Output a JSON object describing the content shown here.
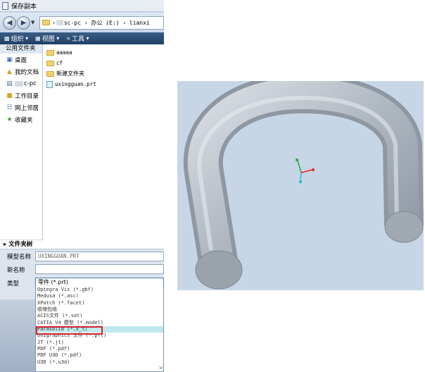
{
  "dialog": {
    "title": "保存副本",
    "address": {
      "path_suffix": "sc-pc",
      "drive": "办公 (E:)",
      "folder": "lianxi"
    },
    "toolbar": {
      "organize": "组织",
      "view": "视图",
      "tools": "工具"
    },
    "sidebar": {
      "header": "公用文件夹",
      "items": [
        {
          "icon": "desktop-icon",
          "label": "桌面"
        },
        {
          "icon": "documents-icon",
          "label": "我的文档"
        },
        {
          "icon": "computer-icon",
          "label": "c-pc"
        },
        {
          "icon": "working-dir-icon",
          "label": "工作目录"
        },
        {
          "icon": "network-icon",
          "label": "网上邻居"
        },
        {
          "icon": "favorites-icon",
          "label": "收藏夹"
        }
      ],
      "folder_tree": "文件夹树"
    },
    "files": [
      {
        "icon": "folder-icon",
        "name": "aaaaa"
      },
      {
        "icon": "folder-icon",
        "name": "cf"
      },
      {
        "icon": "folder-icon",
        "name": "新建文件夹"
      },
      {
        "icon": "part-file-icon",
        "name": "uxingguan.prt"
      }
    ],
    "form": {
      "model_name_label": "模型名称",
      "model_name_value": "UXINGGUAN.PRT",
      "new_name_label": "新名称",
      "new_name_value": "",
      "type_label": "类型",
      "type_value": "零件 (*.prt)"
    },
    "type_options": [
      "Optegra Vis (*.gbf)",
      "Medusa (*.asc)",
      "XPatch (*.facet)",
      "收缩包络",
      "ACIS文件 (*.sat)",
      "CATIA V4 模型 (*.model)",
      "Parasolid (*.x_t)",
      "Unigraphics 文件 (*.prt)",
      "JT (*.jt)",
      "PDF (*.pdf)",
      "PDF U3D (*.pdf)",
      "U3D (*.u3d)"
    ],
    "selected_option_index": 6
  },
  "viewport": {
    "background": "#c7d6e7",
    "model_color": "#b4bcc6",
    "axis_colors": {
      "x": "#e0262d",
      "y": "#2fa04a",
      "z": "#36b6d6"
    }
  }
}
